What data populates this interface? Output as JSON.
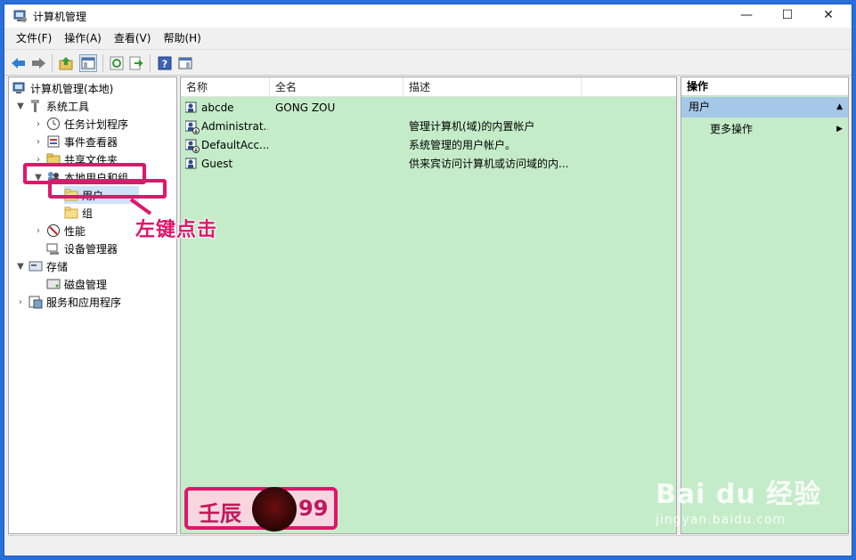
{
  "window": {
    "title": "计算机管理",
    "controls": {
      "minimize": "—",
      "maximize": "☐",
      "close": "✕"
    }
  },
  "menu": [
    "文件(F)",
    "操作(A)",
    "查看(V)",
    "帮助(H)"
  ],
  "toolbar": [
    "back-icon",
    "forward-icon",
    "up-icon",
    "show-tree-icon",
    "refresh-icon",
    "export-icon",
    "help-icon",
    "properties-icon"
  ],
  "tree": {
    "root": "计算机管理(本地)",
    "items": [
      {
        "label": "系统工具",
        "level": 1,
        "chevron": "expanded",
        "icon": "tools-icon"
      },
      {
        "label": "任务计划程序",
        "level": 2,
        "chevron": "collapsed",
        "icon": "clock-icon"
      },
      {
        "label": "事件查看器",
        "level": 2,
        "chevron": "collapsed",
        "icon": "event-viewer-icon"
      },
      {
        "label": "共享文件夹",
        "level": 2,
        "chevron": "collapsed",
        "icon": "shared-folder-icon"
      },
      {
        "label": "本地用户和组",
        "level": 2,
        "chevron": "expanded",
        "icon": "users-groups-icon"
      },
      {
        "label": "用户",
        "level": 3,
        "chevron": "none",
        "icon": "folder-icon",
        "selected": true
      },
      {
        "label": "组",
        "level": 3,
        "chevron": "none",
        "icon": "folder-icon"
      },
      {
        "label": "性能",
        "level": 2,
        "chevron": "collapsed",
        "icon": "performance-icon"
      },
      {
        "label": "设备管理器",
        "level": 2,
        "chevron": "none",
        "icon": "device-manager-icon"
      },
      {
        "label": "存储",
        "level": 1,
        "chevron": "expanded",
        "icon": "storage-icon"
      },
      {
        "label": "磁盘管理",
        "level": 2,
        "chevron": "none",
        "icon": "disk-icon"
      },
      {
        "label": "服务和应用程序",
        "level": 1,
        "chevron": "collapsed",
        "icon": "services-icon"
      }
    ]
  },
  "list": {
    "columns": [
      "名称",
      "全名",
      "描述"
    ],
    "rows": [
      {
        "name": "abcde",
        "full_name": "GONG ZOU",
        "description": ""
      },
      {
        "name": "Administrat...",
        "full_name": "",
        "description": "管理计算机(域)的内置帐户"
      },
      {
        "name": "DefaultAcc...",
        "full_name": "",
        "description": "系统管理的用户帐户。"
      },
      {
        "name": "Guest",
        "full_name": "",
        "description": "供来宾访问计算机或访问域的内..."
      }
    ]
  },
  "actions": {
    "header": "操作",
    "section": "用户",
    "more": "更多操作"
  },
  "annotations": {
    "callout": "左键点击",
    "badge_left": "壬辰",
    "badge_right": "99",
    "highlight_color": "#e0166b"
  },
  "watermark": {
    "main": "Bai du 经验",
    "sub": "jingyan.baidu.com"
  },
  "colors": {
    "pane_background": "#c5ecc9",
    "action_section": "#a6c8e8",
    "window_border": "#1a57c7"
  }
}
